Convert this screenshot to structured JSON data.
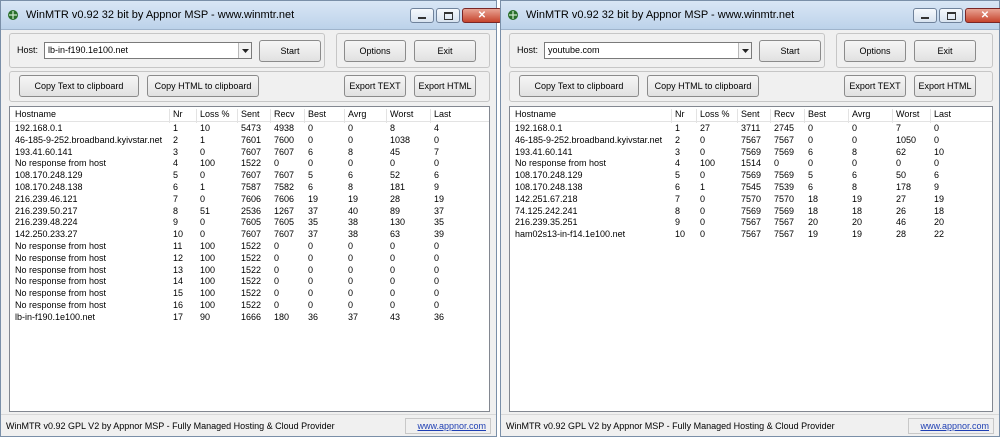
{
  "windows": [
    {
      "title": "WinMTR v0.92 32 bit by Appnor MSP - www.winmtr.net",
      "host_label": "Host:",
      "host_value": "lb-in-f190.1e100.net",
      "buttons": {
        "start": "Start",
        "options": "Options",
        "exit": "Exit",
        "copy_text": "Copy Text to clipboard",
        "copy_html": "Copy HTML to clipboard",
        "export_text": "Export TEXT",
        "export_html": "Export HTML"
      },
      "columns": [
        "Hostname",
        "Nr",
        "Loss %",
        "Sent",
        "Recv",
        "Best",
        "Avrg",
        "Worst",
        "Last"
      ],
      "rows": [
        [
          "192.168.0.1",
          "1",
          "10",
          "5473",
          "4938",
          "0",
          "0",
          "8",
          "4"
        ],
        [
          "46-185-9-252.broadband.kyivstar.net",
          "2",
          "1",
          "7601",
          "7600",
          "0",
          "0",
          "1038",
          "0"
        ],
        [
          "193.41.60.141",
          "3",
          "0",
          "7607",
          "7607",
          "6",
          "8",
          "45",
          "7"
        ],
        [
          "No response from host",
          "4",
          "100",
          "1522",
          "0",
          "0",
          "0",
          "0",
          "0"
        ],
        [
          "108.170.248.129",
          "5",
          "0",
          "7607",
          "7607",
          "5",
          "6",
          "52",
          "6"
        ],
        [
          "108.170.248.138",
          "6",
          "1",
          "7587",
          "7582",
          "6",
          "8",
          "181",
          "9"
        ],
        [
          "216.239.46.121",
          "7",
          "0",
          "7606",
          "7606",
          "19",
          "19",
          "28",
          "19"
        ],
        [
          "216.239.50.217",
          "8",
          "51",
          "2536",
          "1267",
          "37",
          "40",
          "89",
          "37"
        ],
        [
          "216.239.48.224",
          "9",
          "0",
          "7605",
          "7605",
          "35",
          "38",
          "130",
          "35"
        ],
        [
          "142.250.233.27",
          "10",
          "0",
          "7607",
          "7607",
          "37",
          "38",
          "63",
          "39"
        ],
        [
          "No response from host",
          "11",
          "100",
          "1522",
          "0",
          "0",
          "0",
          "0",
          "0"
        ],
        [
          "No response from host",
          "12",
          "100",
          "1522",
          "0",
          "0",
          "0",
          "0",
          "0"
        ],
        [
          "No response from host",
          "13",
          "100",
          "1522",
          "0",
          "0",
          "0",
          "0",
          "0"
        ],
        [
          "No response from host",
          "14",
          "100",
          "1522",
          "0",
          "0",
          "0",
          "0",
          "0"
        ],
        [
          "No response from host",
          "15",
          "100",
          "1522",
          "0",
          "0",
          "0",
          "0",
          "0"
        ],
        [
          "No response from host",
          "16",
          "100",
          "1522",
          "0",
          "0",
          "0",
          "0",
          "0"
        ],
        [
          "lb-in-f190.1e100.net",
          "17",
          "90",
          "1666",
          "180",
          "36",
          "37",
          "43",
          "36"
        ]
      ],
      "status_text": "WinMTR v0.92 GPL V2 by Appnor MSP - Fully Managed Hosting & Cloud Provider",
      "status_link": "www.appnor.com"
    },
    {
      "title": "WinMTR v0.92 32 bit by Appnor MSP - www.winmtr.net",
      "host_label": "Host:",
      "host_value": "youtube.com",
      "buttons": {
        "start": "Start",
        "options": "Options",
        "exit": "Exit",
        "copy_text": "Copy Text to clipboard",
        "copy_html": "Copy HTML to clipboard",
        "export_text": "Export TEXT",
        "export_html": "Export HTML"
      },
      "columns": [
        "Hostname",
        "Nr",
        "Loss %",
        "Sent",
        "Recv",
        "Best",
        "Avrg",
        "Worst",
        "Last"
      ],
      "rows": [
        [
          "192.168.0.1",
          "1",
          "27",
          "3711",
          "2745",
          "0",
          "0",
          "7",
          "0"
        ],
        [
          "46-185-9-252.broadband.kyivstar.net",
          "2",
          "0",
          "7567",
          "7567",
          "0",
          "0",
          "1050",
          "0"
        ],
        [
          "193.41.60.141",
          "3",
          "0",
          "7569",
          "7569",
          "6",
          "8",
          "62",
          "10"
        ],
        [
          "No response from host",
          "4",
          "100",
          "1514",
          "0",
          "0",
          "0",
          "0",
          "0"
        ],
        [
          "108.170.248.129",
          "5",
          "0",
          "7569",
          "7569",
          "5",
          "6",
          "50",
          "6"
        ],
        [
          "108.170.248.138",
          "6",
          "1",
          "7545",
          "7539",
          "6",
          "8",
          "178",
          "9"
        ],
        [
          "142.251.67.218",
          "7",
          "0",
          "7570",
          "7570",
          "18",
          "19",
          "27",
          "19"
        ],
        [
          "74.125.242.241",
          "8",
          "0",
          "7569",
          "7569",
          "18",
          "18",
          "26",
          "18"
        ],
        [
          "216.239.35.251",
          "9",
          "0",
          "7567",
          "7567",
          "20",
          "20",
          "46",
          "20"
        ],
        [
          "ham02s13-in-f14.1e100.net",
          "10",
          "0",
          "7567",
          "7567",
          "19",
          "19",
          "28",
          "22"
        ]
      ],
      "status_text": "WinMTR v0.92 GPL V2 by Appnor MSP - Fully Managed Hosting & Cloud Provider",
      "status_link": "www.appnor.com"
    }
  ]
}
